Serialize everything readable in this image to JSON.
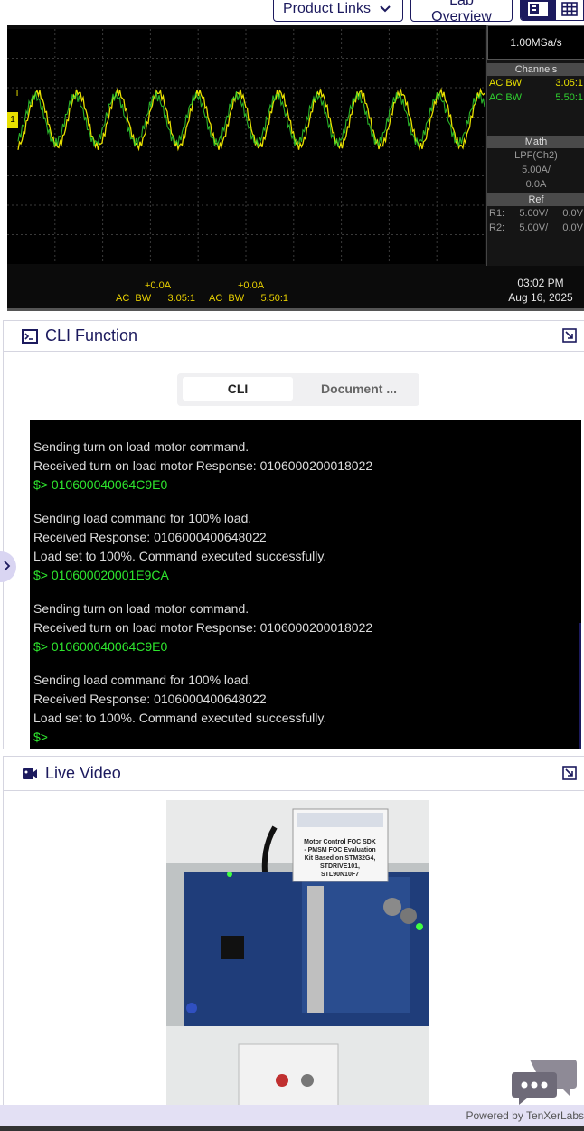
{
  "toolbar": {
    "product_links_label": "Product Links",
    "lab_overview_label": "Lab Overview"
  },
  "scope": {
    "sample_rate": "1.00MSa/s",
    "channels_head": "Channels",
    "ch1_label": "AC BW",
    "ch1_value": "3.05:1",
    "ch2_label": "AC BW",
    "ch2_value": "5.50:1",
    "math_head": "Math",
    "math_line1": "LPF(Ch2)",
    "math_line2": "5.00A/",
    "math_line3": "0.0A",
    "ref_head": "Ref",
    "r1_label": "R1:",
    "r1_scale": "5.00V/",
    "r1_offset": "0.0V",
    "r2_label": "R2:",
    "r2_scale": "5.00V/",
    "r2_offset": "0.0V",
    "bottom_offset1": "+0.0A",
    "bottom_offset2": "+0.0A",
    "bottom_ch1": "AC  BW      3.05:1",
    "bottom_ch2": "AC  BW      5.50:1",
    "time": "03:02 PM",
    "date": "Aug 16, 2025",
    "trigger_marker": "T",
    "channel_marker": "1"
  },
  "cli_panel": {
    "title": "CLI Function",
    "tab_cli": "CLI",
    "tab_document": "Document ...",
    "terminal_lines": [
      {
        "text": "Sending turn on load motor command.",
        "type": "output"
      },
      {
        "text": "Received turn on load motor Response: 0106000200018022",
        "type": "output"
      },
      {
        "text": "$> 010600040064C9E0",
        "type": "prompt"
      },
      {
        "text": "",
        "type": "gap"
      },
      {
        "text": "Sending load command for 100% load.",
        "type": "output"
      },
      {
        "text": "Received Response: 0106000400648022",
        "type": "output"
      },
      {
        "text": "Load set to 100%. Command executed successfully.",
        "type": "output"
      },
      {
        "text": "$> 010600020001E9CA",
        "type": "prompt"
      },
      {
        "text": "",
        "type": "gap"
      },
      {
        "text": "Sending turn on load motor command.",
        "type": "output"
      },
      {
        "text": "Received turn on load motor Response: 0106000200018022",
        "type": "output"
      },
      {
        "text": "$> 010600040064C9E0",
        "type": "prompt"
      },
      {
        "text": "",
        "type": "gap"
      },
      {
        "text": "Sending load command for 100% load.",
        "type": "output"
      },
      {
        "text": "Received Response: 0106000400648022",
        "type": "output"
      },
      {
        "text": "Load set to 100%. Command executed successfully.",
        "type": "output"
      },
      {
        "text": "$>",
        "type": "prompt"
      }
    ]
  },
  "video_panel": {
    "title": "Live Video",
    "board_label_line1": "Motor Control FOC SDK",
    "board_label_line2": "- PMSM FOC Evaluation",
    "board_label_line3": "Kit Based on STM32G4,",
    "board_label_line4": "STDRIVE101,",
    "board_label_line5": "STL90N10F7"
  },
  "footer": {
    "powered_by": "Powered by TenXerLabs"
  },
  "colors": {
    "brand": "#1c1a5e",
    "trace_yellow": "#e8e000",
    "trace_green": "#30d030",
    "terminal_prompt": "#2ee62e"
  }
}
